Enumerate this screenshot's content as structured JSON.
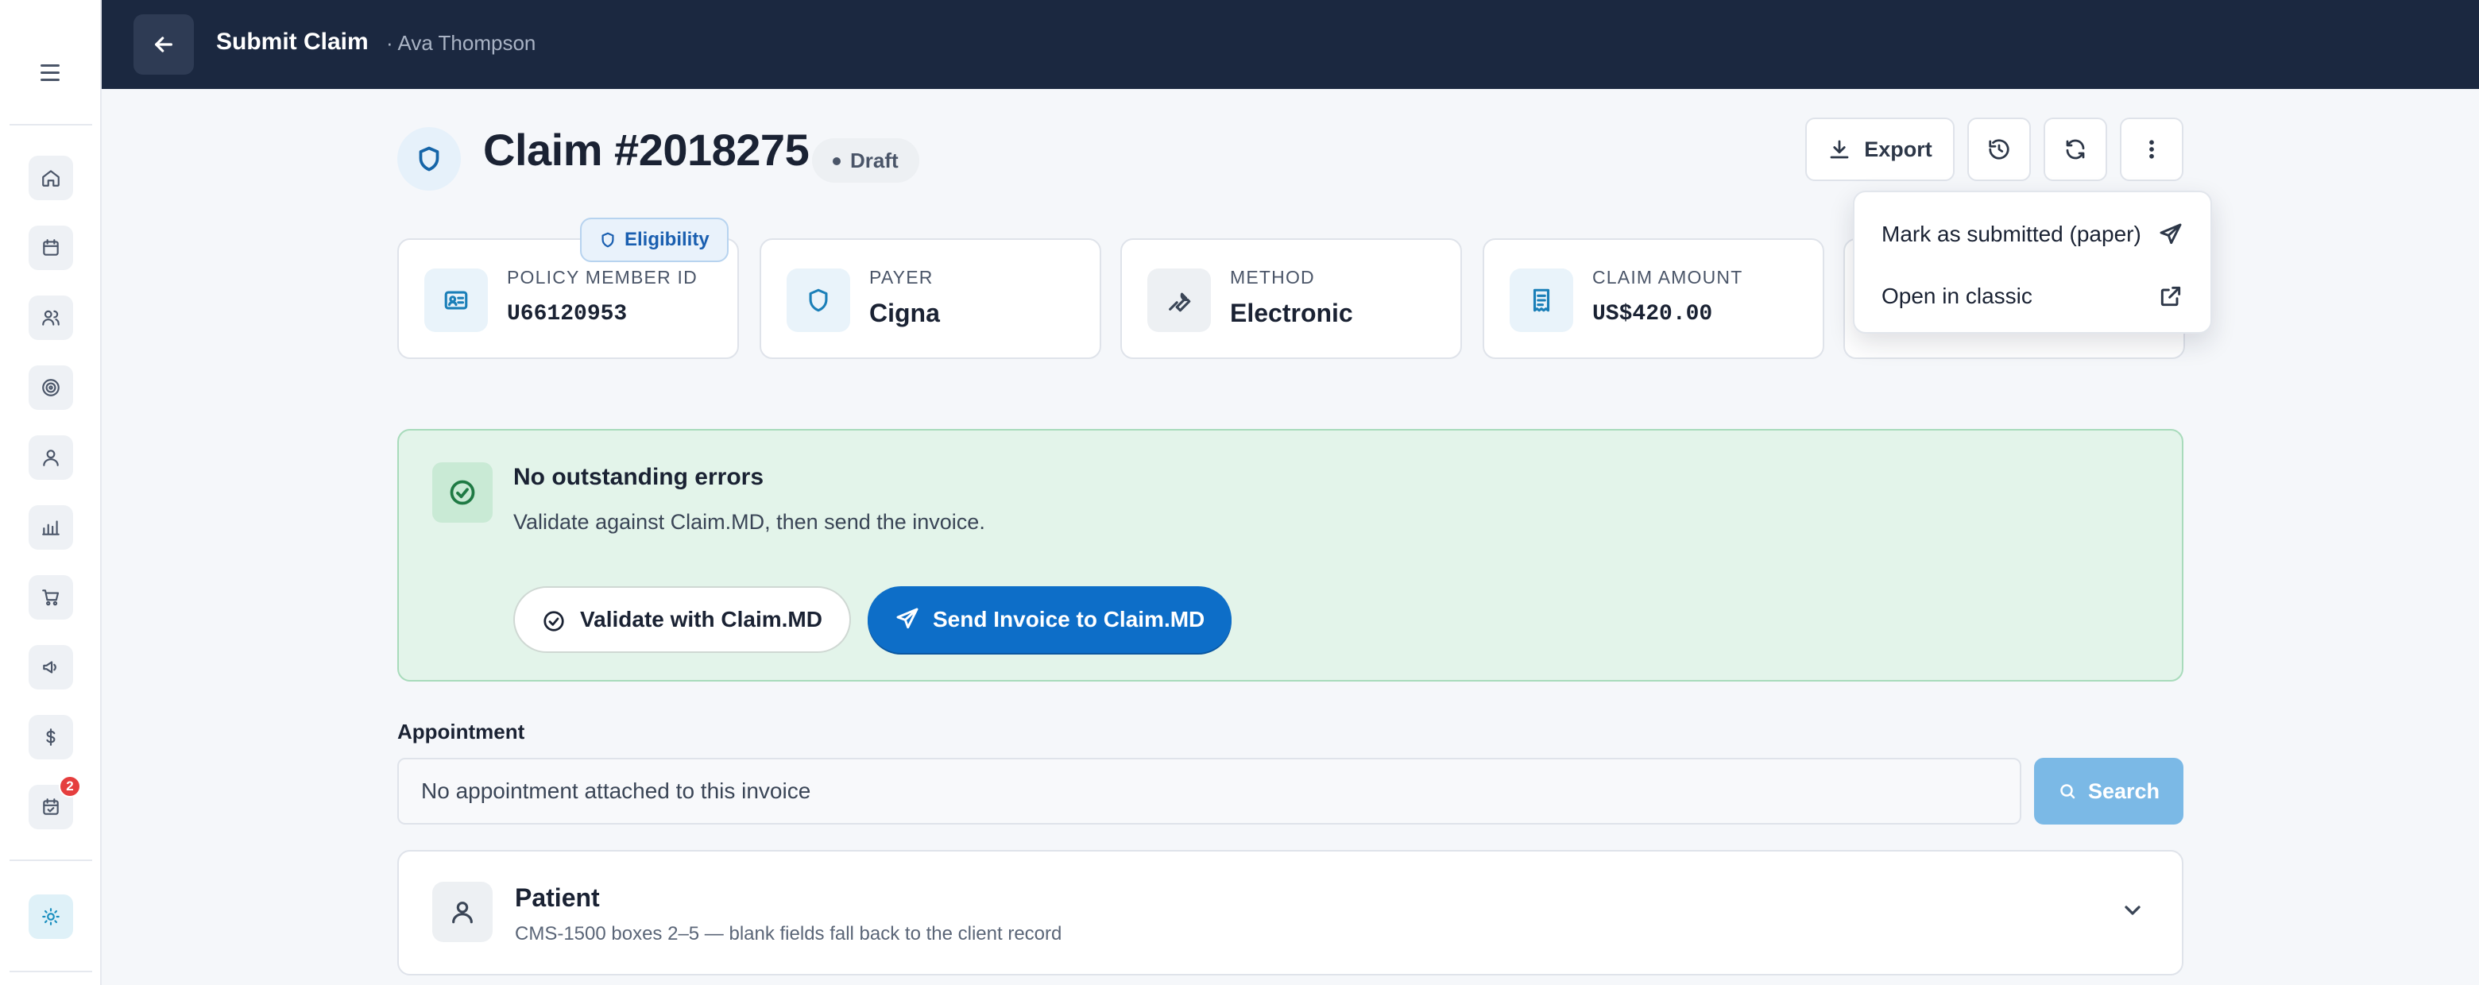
{
  "topbar": {
    "title": "Submit Claim",
    "subtitle": "· Ava Thompson"
  },
  "sidebar": {
    "items": [
      {
        "icon": "home-icon"
      },
      {
        "icon": "calendar-icon"
      },
      {
        "icon": "clients-icon"
      },
      {
        "icon": "target-icon"
      },
      {
        "icon": "user-icon"
      },
      {
        "icon": "bar-chart-icon"
      },
      {
        "icon": "cart-icon"
      },
      {
        "icon": "megaphone-icon"
      },
      {
        "icon": "dollar-icon"
      },
      {
        "icon": "calendar-check-icon",
        "badge": "2"
      },
      {
        "icon": "sun-icon",
        "active": true
      }
    ]
  },
  "header": {
    "claim_title": "Claim #2018275",
    "status": "Draft",
    "export_label": "Export"
  },
  "menu": {
    "items": [
      {
        "label": "Mark as submitted (paper)",
        "icon": "send-icon"
      },
      {
        "label": "Open in classic",
        "icon": "external-link-icon"
      }
    ]
  },
  "cards": [
    {
      "label": "Policy Member ID",
      "value": "U66120953",
      "icon": "id-card-icon",
      "badge": "Eligibility"
    },
    {
      "label": "Payer",
      "value": "Cigna",
      "icon": "shield-icon"
    },
    {
      "label": "Method",
      "value": "Electronic",
      "icon": "wrench-icon"
    },
    {
      "label": "Claim Amount",
      "value": "US$420.00",
      "icon": "receipt-icon"
    }
  ],
  "status_panel": {
    "title": "No outstanding errors",
    "text": "Validate against Claim.MD, then send the invoice.",
    "validate_label": "Validate with Claim.MD",
    "send_label": "Send Invoice to Claim.MD"
  },
  "appointment": {
    "label": "Appointment",
    "placeholder": "No appointment attached to this invoice",
    "search_label": "Search"
  },
  "patient": {
    "title": "Patient",
    "subtitle": "CMS-1500 boxes 2–5 — blank fields fall back to the client record"
  },
  "colors": {
    "topbar": "#1b2840",
    "primary": "#0d6ec8",
    "success_bg": "#e3f4ea",
    "success_border": "#a8dbbb"
  }
}
